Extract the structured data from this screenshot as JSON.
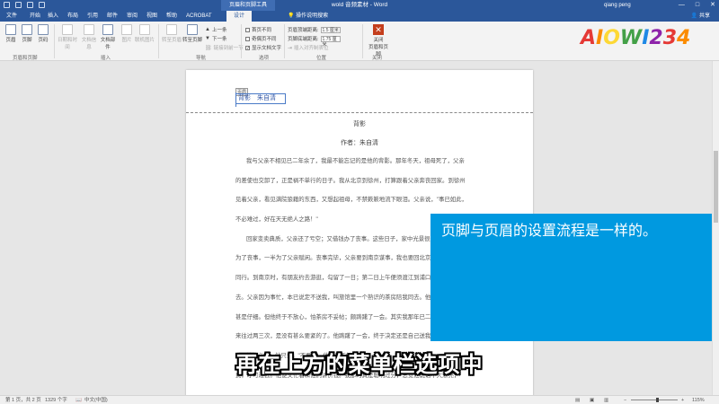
{
  "titlebar": {
    "context_group": "页眉和页脚工具",
    "doc_title": "wold 音频素材 - Word",
    "user": "qiang peng",
    "window_controls": [
      "—",
      "□",
      "✕"
    ]
  },
  "tabs": [
    "文件",
    "开始",
    "插入",
    "布局",
    "引用",
    "邮件",
    "审阅",
    "视图",
    "帮助",
    "ACROBAT",
    "设计"
  ],
  "active_tab": "设计",
  "tell_me": "操作说明搜索",
  "share": "共享",
  "ribbon": {
    "header_footer_group": {
      "label": "页眉和页脚",
      "buttons": [
        "页眉",
        "页脚",
        "页码"
      ]
    },
    "insert_group": {
      "label": "插入",
      "buttons": [
        "日期和时间",
        "文档信息",
        "文档部件",
        "图片",
        "联机图片"
      ]
    },
    "nav_group": {
      "label": "导航",
      "goto_header": "转至页眉",
      "goto_footer": "转至页脚",
      "prev": "上一条",
      "next": "下一条",
      "link_prev": "链接到前一节"
    },
    "options_group": {
      "label": "选项",
      "opt1": "首页不同",
      "opt2": "奇偶页不同",
      "opt3": "显示文档文字",
      "opt3_checked": true
    },
    "position_group": {
      "label": "位置",
      "header_top_label": "页眉顶端距离:",
      "header_top_value": "1.5 厘米",
      "footer_bottom_label": "页脚底端距离:",
      "footer_bottom_value": "1.75 厘米",
      "insert_align_tab": "插入对齐制表位"
    },
    "close_group": {
      "label": "关闭",
      "close_button": "关闭\n页眉和页脚"
    }
  },
  "logo": {
    "text": "AIOWI234",
    "colors": [
      "#e53935",
      "#fb8c00",
      "#fdd835",
      "#43a047",
      "#1e88e5",
      "#8e24aa",
      "#e53935",
      "#fb8c00"
    ]
  },
  "document": {
    "header_tag": "页眉",
    "header_text": "背影　朱自清",
    "title": "背影",
    "author": "作者：朱自清",
    "paragraphs": [
      "我与父亲不相见已二年余了，我最不能忘记的是他的背影。那年冬天，祖母死了，父亲",
      "的差使也交卸了，正是祸不单行的日子。我从北京到徐州，打算跟着父亲奔丧回家。到徐州",
      "见着父亲，看见满院狼藉的东西，又想起祖母，不禁簌簌地流下眼泪。父亲说，\"事已如此，",
      "不必难过，好在天无绝人之路！\"",
      "回家变卖典质，父亲还了亏空；又借钱办了丧事。这些日子，家中光景很是惨淡，一半",
      "为了丧事，一半为了父亲赋闲。丧事完毕，父亲要到南京谋事，我也要回北京念书，我们便",
      "同行。到南京时，有朋友约去游逛，勾留了一日；第二日上午便须渡江到浦口，下午上车北",
      "去。父亲因为事忙，本已说定不送我，叫旅馆里一个熟识的茶房陪我同去。他再三嘱咐茶房，",
      "甚是仔细。但他终于不放心，怕茶房不妥帖；颇踌躇了一会。其实我那年已二十岁，北京已",
      "来往过两三次，是没有甚么要紧的了。他踌躇了一会，终于决定还是自己送我去。我再三劝",
      "他不必去；他只说，\"不要紧，他们去不好！\"",
      "费，才可过去。他便又忙着和他们讲价钱。我那时真是聪明过分，总觉他说话不大漂亮，"
    ]
  },
  "left_header_tag": "页眉",
  "overlay_text": "页脚与页眉的设置流程是一样的。",
  "subtitle": "再在上方的菜单栏选项中",
  "status": {
    "page": "第 1 页，共 2 页",
    "words": "1329 个字",
    "lang": "中文(中国)",
    "zoom": "115%"
  }
}
